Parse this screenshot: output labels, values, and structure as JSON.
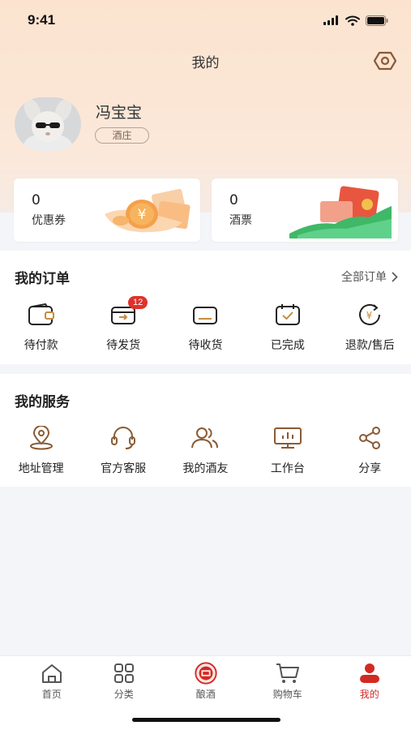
{
  "status": {
    "time": "9:41"
  },
  "header": {
    "title": "我的"
  },
  "profile": {
    "name": "冯宝宝",
    "tag": "酒庄"
  },
  "assets": [
    {
      "value": "0",
      "label": "优惠券"
    },
    {
      "value": "0",
      "label": "酒票"
    }
  ],
  "orders": {
    "title": "我的订单",
    "all_label": "全部订单",
    "items": [
      {
        "label": "待付款",
        "icon": "wallet-icon"
      },
      {
        "label": "待发货",
        "icon": "shipping-icon",
        "badge": "12"
      },
      {
        "label": "待收货",
        "icon": "receive-icon"
      },
      {
        "label": "已完成",
        "icon": "completed-icon"
      },
      {
        "label": "退款/售后",
        "icon": "refund-icon"
      }
    ]
  },
  "services": {
    "title": "我的服务",
    "items": [
      {
        "label": "地址管理",
        "icon": "location-icon"
      },
      {
        "label": "官方客服",
        "icon": "headset-icon"
      },
      {
        "label": "我的酒友",
        "icon": "friends-icon"
      },
      {
        "label": "工作台",
        "icon": "monitor-icon"
      },
      {
        "label": "分享",
        "icon": "share-icon"
      }
    ]
  },
  "tabbar": {
    "items": [
      {
        "label": "首页",
        "icon": "home-icon"
      },
      {
        "label": "分类",
        "icon": "category-icon"
      },
      {
        "label": "酿酒",
        "icon": "brew-icon"
      },
      {
        "label": "购物车",
        "icon": "cart-icon"
      },
      {
        "label": "我的",
        "icon": "user-icon"
      }
    ],
    "active": "我的"
  },
  "colors": {
    "accent": "#d22a22",
    "brown": "#8a5a33",
    "hero_bg": "#fbe3cf"
  }
}
